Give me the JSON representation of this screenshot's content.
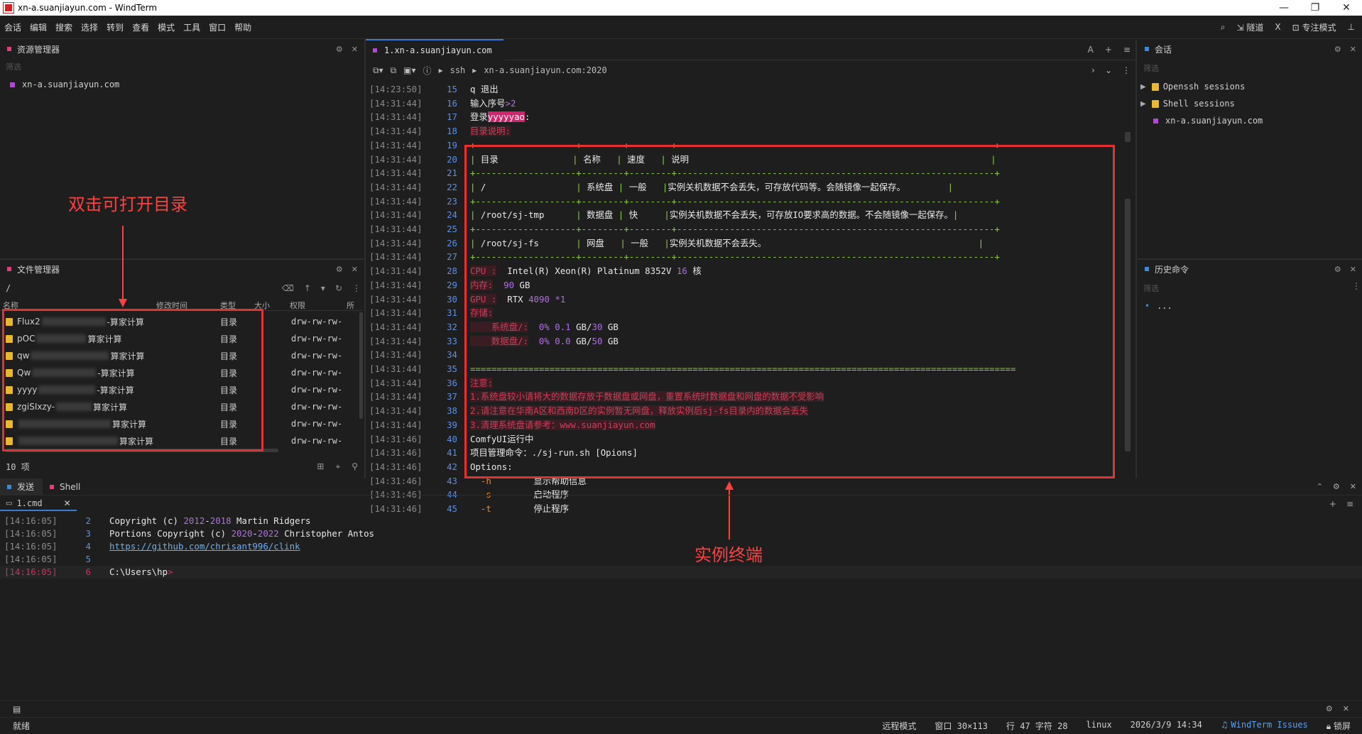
{
  "window": {
    "title": "xn-a.suanjiayun.com - WindTerm",
    "min": "—",
    "max": "❐",
    "close": "✕"
  },
  "menu": [
    "会话",
    "编辑",
    "搜索",
    "选择",
    "转到",
    "查看",
    "模式",
    "工具",
    "窗口",
    "帮助"
  ],
  "menu_right": {
    "tunnel": "隧道",
    "focus": "专注模式",
    "x": "X"
  },
  "explorer": {
    "title": "资源管理器",
    "filter": "筛选",
    "item": "xn-a.suanjiayun.com"
  },
  "file_manager": {
    "title": "文件管理器",
    "path": "/",
    "columns": [
      "名称",
      "修改时间",
      "类型",
      "大小",
      "权限",
      "所"
    ],
    "rows": [
      {
        "prefix": "Flux2",
        "suffix": "-算家计算",
        "type": "目录",
        "perm": "drw-rw-rw-"
      },
      {
        "prefix": "pOC",
        "suffix": "算家计算",
        "type": "目录",
        "perm": "drw-rw-rw-"
      },
      {
        "prefix": "qw",
        "suffix": "算家计算",
        "type": "目录",
        "perm": "drw-rw-rw-"
      },
      {
        "prefix": "Qw",
        "suffix": "-算家计算",
        "type": "目录",
        "perm": "drw-rw-rw-"
      },
      {
        "prefix": "yyyy",
        "suffix": "-算家计算",
        "type": "目录",
        "perm": "drw-rw-rw-"
      },
      {
        "prefix": "zgiSIxzy-",
        "suffix": "算家计算",
        "type": "目录",
        "perm": "drw-rw-rw-"
      },
      {
        "prefix": "",
        "suffix": "算家计算",
        "type": "目录",
        "perm": "drw-rw-rw-"
      },
      {
        "prefix": "",
        "suffix": "算家计算",
        "type": "目录",
        "perm": "drw-rw-rw-"
      }
    ],
    "count": "10 项"
  },
  "annotations": {
    "left": "双击可打开目录",
    "right": "实例终端"
  },
  "terminal": {
    "tab": "1.xn-a.suanjiayun.com",
    "breadcrumb_ssh": "ssh",
    "breadcrumb_host": "xn-a.suanjiayun.com:2020",
    "lines": [
      {
        "ts": "[14:23:50]",
        "n": "15",
        "html": "q 退出"
      },
      {
        "ts": "[14:31:44]",
        "n": "16",
        "html": "输入序号<span class='violet'>&gt;2</span>"
      },
      {
        "ts": "[14:31:44]",
        "n": "17",
        "html": "登录<span class='pinkbg'>yyyyyao</span>:"
      },
      {
        "ts": "[14:31:44]",
        "n": "18",
        "html": "<span class='redbg'>目录说明:</span>"
      },
      {
        "ts": "[14:31:44]",
        "n": "19",
        "html": "<span class='green'>+-------------------+--------+--------+------------------------------------------------------------+</span>"
      },
      {
        "ts": "[14:31:44]",
        "n": "20",
        "html": "<span class='green'>|</span> 目录              <span class='green'>|</span> 名称   <span class='green'>|</span> 速度   <span class='green'>|</span> 说明                                                         <span class='green'>|</span>"
      },
      {
        "ts": "[14:31:44]",
        "n": "21",
        "html": "<span class='green'>+-------------------+--------+--------+------------------------------------------------------------+</span>"
      },
      {
        "ts": "[14:31:44]",
        "n": "22",
        "html": "<span class='green'>|</span> /                 <span class='green'>|</span> 系统盘 <span class='green'>|</span> 一般   <span class='green'>|</span>实例关机数据不会丢失，可存放代码等。会随镜像一起保存。        <span class='green'>|</span>"
      },
      {
        "ts": "[14:31:44]",
        "n": "23",
        "html": "<span class='green'>+-------------------+--------+--------+------------------------------------------------------------+</span>"
      },
      {
        "ts": "[14:31:44]",
        "n": "24",
        "html": "<span class='green'>|</span> /root/sj-tmp      <span class='green'>|</span> 数据盘 <span class='green'>|</span> 快     <span class='green'>|</span>实例关机数据不会丢失，可存放IO要求高的数据。不会随镜像一起保存。<span class='green'>|</span>"
      },
      {
        "ts": "[14:31:44]",
        "n": "25",
        "html": "<span class='green'>+-------------------+--------+--------+------------------------------------------------------------+</span>"
      },
      {
        "ts": "[14:31:44]",
        "n": "26",
        "html": "<span class='green'>|</span> /root/sj-fs       <span class='green'>|</span> 网盘   <span class='green'>|</span> 一般   <span class='green'>|</span>实例关机数据不会丢失。                                        <span class='green'>|</span>"
      },
      {
        "ts": "[14:31:44]",
        "n": "27",
        "html": "<span class='green'>+-------------------+--------+--------+------------------------------------------------------------+</span>"
      },
      {
        "ts": "[14:31:44]",
        "n": "28",
        "html": "<span class='redbg'>CPU :</span>  Intel(R) Xeon(R) Platinum 8352V <span class='violet'>16</span> 核"
      },
      {
        "ts": "[14:31:44]",
        "n": "29",
        "html": "<span class='redbg'>内存:</span>  <span class='violet'>90</span> GB"
      },
      {
        "ts": "[14:31:44]",
        "n": "30",
        "html": "<span class='redbg'>GPU :</span>  RTX <span class='violet'>4090</span> <span class='violet'>*1</span>"
      },
      {
        "ts": "[14:31:44]",
        "n": "31",
        "html": "<span class='redbg'>存储:</span>"
      },
      {
        "ts": "[14:31:44]",
        "n": "32",
        "html": "<span class='redbg'>    系统盘/:</span>  <span class='violet'>0%</span> <span class='violet'>0.1</span> GB/<span class='violet'>30</span> GB"
      },
      {
        "ts": "[14:31:44]",
        "n": "33",
        "html": "<span class='redbg'>    数据盘/:</span>  <span class='violet'>0%</span> <span class='violet'>0.0</span> GB/<span class='violet'>50</span> GB"
      },
      {
        "ts": "[14:31:44]",
        "n": "34",
        "html": ""
      },
      {
        "ts": "[14:31:44]",
        "n": "35",
        "html": "<span class='green'>=======================================================================================================</span>"
      },
      {
        "ts": "[14:31:44]",
        "n": "36",
        "html": "<span class='redbg'>注意:</span>"
      },
      {
        "ts": "[14:31:44]",
        "n": "37",
        "html": "<span class='redbg'>1.系统盘较小请将大的数据存放于数据盘或网盘，重置系统时数据盘和网盘的数据不受影响</span>"
      },
      {
        "ts": "[14:31:44]",
        "n": "38",
        "html": "<span class='redbg'>2.请注意在华南A区和西南D区的实例暂无网盘，释放实例后sj-fs目录内的数据会丢失</span>"
      },
      {
        "ts": "[14:31:44]",
        "n": "39",
        "html": "<span class='redbg'>3.清理系统盘请参考：www.suanjiayun.com</span>"
      },
      {
        "ts": "[14:31:46]",
        "n": "40",
        "html": "ComfyUI运行中"
      },
      {
        "ts": "[14:31:46]",
        "n": "41",
        "html": "项目管理命令：./sj-run.sh [Opions]"
      },
      {
        "ts": "[14:31:46]",
        "n": "42",
        "html": "Options:"
      },
      {
        "ts": "[14:31:46]",
        "n": "43",
        "html": "  <span class='orange'>-h</span>        显示帮助信息"
      },
      {
        "ts": "[14:31:46]",
        "n": "44",
        "html": "  <span class='orange'>-s</span>        启动程序"
      },
      {
        "ts": "[14:31:46]",
        "n": "45",
        "html": "  <span class='orange'>-t</span>        停止程序"
      }
    ]
  },
  "sessions": {
    "title": "会话",
    "filter": "筛选",
    "items": [
      "Openssh sessions",
      "Shell sessions",
      "xn-a.suanjiayun.com"
    ]
  },
  "history": {
    "title": "历史命令",
    "filter": "筛选",
    "item": "..."
  },
  "bottom": {
    "tabs": [
      "发送",
      "Shell"
    ],
    "subtab": "1.cmd",
    "lines": [
      {
        "ts": "[14:16:05]",
        "n": "2",
        "html": "Copyright (c) <span class='violet'>2012</span>-<span class='violet'>2018</span> Martin Ridgers"
      },
      {
        "ts": "[14:16:05]",
        "n": "3",
        "html": "Portions Copyright (c) <span class='violet'>2020</span>-<span class='violet'>2022</span> Christopher Antos"
      },
      {
        "ts": "[14:16:05]",
        "n": "4",
        "html": "<span style='color:#6ab0f0;text-decoration:underline'>https://github.com/chrisant996/clink</span>"
      },
      {
        "ts": "[14:16:05]",
        "n": "5",
        "html": ""
      },
      {
        "ts": "[14:16:05]",
        "n": "6",
        "html": "C:\\Users\\hp<span class='red'>&gt;</span>"
      }
    ]
  },
  "status": {
    "left": "就绪",
    "items": [
      "远程模式",
      "窗口 30×113",
      "行 47 字符 28",
      "linux",
      "2026/3/9 14:34",
      "WindTerm Issues",
      "锁屏"
    ]
  }
}
